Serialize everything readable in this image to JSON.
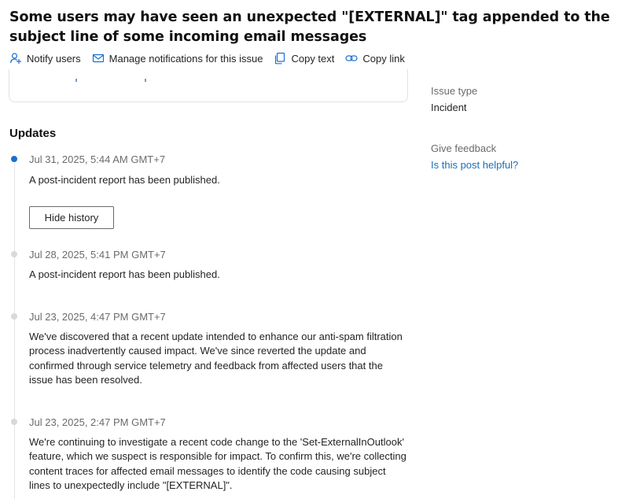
{
  "issue": {
    "title": "Some users may have seen an unexpected \"[EXTERNAL]\" tag appended to the subject line of some incoming email messages"
  },
  "actions": [
    {
      "label": "Notify users",
      "icon": "person-add-icon"
    },
    {
      "label": "Manage notifications for this issue",
      "icon": "mail-icon"
    },
    {
      "label": "Copy text",
      "icon": "copy-icon"
    },
    {
      "label": "Copy link",
      "icon": "link-icon"
    }
  ],
  "details": {
    "issue_type_label": "Issue type",
    "issue_type_value": "Incident",
    "feedback_label": "Give feedback",
    "feedback_link": "Is this post helpful?"
  },
  "updates": {
    "heading": "Updates",
    "hide_history_label": "Hide history",
    "entries": [
      {
        "date": "Jul 31, 2025, 5:44 AM GMT+7",
        "text": "A post-incident report has been published."
      },
      {
        "date": "Jul 28, 2025, 5:41 PM GMT+7",
        "text": "A post-incident report has been published."
      },
      {
        "date": "Jul 23, 2025, 4:47 PM GMT+7",
        "text": "We've discovered that a recent update intended to enhance our anti-spam filtration process inadvertently caused impact. We've since reverted the update and confirmed through service telemetry and feedback from affected users that the issue has been resolved."
      },
      {
        "date": "Jul 23, 2025, 2:47 PM GMT+7",
        "text": "We're continuing to investigate a recent code change to the 'Set-ExternalInOutlook' feature, which we suspect is responsible for impact. To confirm this, we're collecting content traces for affected email messages to identify the code causing subject lines to unexpectedly include \"[EXTERNAL]\"."
      }
    ]
  },
  "colors": {
    "accent": "#1a6fd0",
    "link": "#1a6fb8",
    "text": "#242424",
    "muted": "#6b6b6b"
  }
}
